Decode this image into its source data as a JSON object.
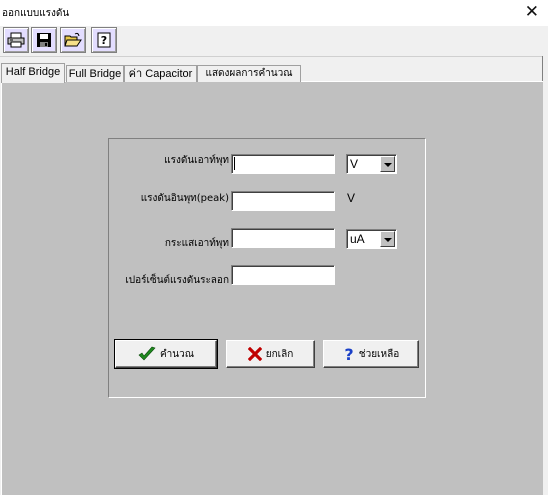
{
  "window": {
    "title": "ออกแบบแรงดัน",
    "close_glyph": "✕"
  },
  "toolbar": {
    "buttons": [
      {
        "name": "print-icon",
        "tooltip": ""
      },
      {
        "name": "save-icon",
        "tooltip": ""
      },
      {
        "name": "open-folder-icon",
        "tooltip": ""
      },
      {
        "name": "help-icon",
        "tooltip": ""
      }
    ]
  },
  "tabs": [
    {
      "label": "Half Bridge",
      "active": true
    },
    {
      "label": "Full Bridge",
      "active": false
    },
    {
      "label": "ค่า Capacitor",
      "active": false
    },
    {
      "label": "แสดงผลการคำนวณ",
      "active": false
    }
  ],
  "form": {
    "output_voltage": {
      "label": "แรงดันเอาท์พุท",
      "value": "",
      "unit": "V"
    },
    "input_voltage_peak": {
      "label": "แรงดันอินพุท(peak)",
      "value": "",
      "unit": "V"
    },
    "output_current": {
      "label": "กระแสเอาท์พุท",
      "value": "",
      "unit": "uA"
    },
    "ripple_percent": {
      "label": "เปอร์เซ็นต์แรงดันระลอก",
      "value": ""
    }
  },
  "buttons": {
    "calculate": "คำนวณ",
    "cancel": "ยกเลิก",
    "help": "ช่วยเหลือ"
  },
  "colors": {
    "tab_body": "#c0c0c0",
    "toolbar_button": "#e3ddff",
    "check_green": "#1f8a1f",
    "cancel_red": "#c00000",
    "help_blue": "#1a40c8"
  }
}
